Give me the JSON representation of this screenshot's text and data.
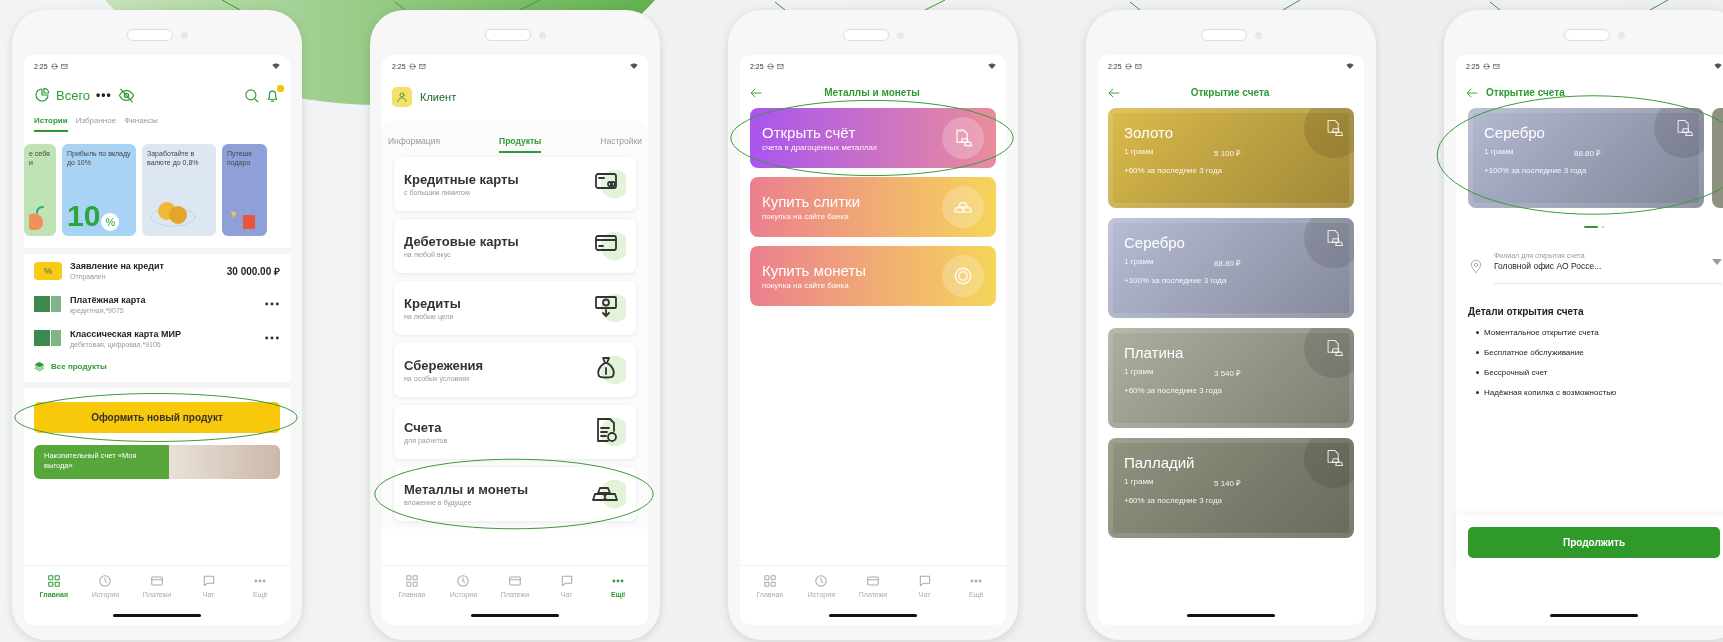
{
  "screens": [
    {
      "kind": "home",
      "status_bar": {
        "time": "2:25"
      },
      "header": {
        "title": "Всего",
        "balance_mask": "•••"
      },
      "tabs": [
        {
          "label": "Истории",
          "selected": true
        },
        {
          "label": "Избранное",
          "selected": false
        },
        {
          "label": "Финансы",
          "selected": false
        }
      ],
      "stories": [
        {
          "kind": "heart",
          "text": "е себя и",
          "color": "#bfe3b4"
        },
        {
          "kind": "percent",
          "text": "Прибыль по вкладу до 10%",
          "art_text": "10",
          "art_mark": "%",
          "color": "#a9d3f5"
        },
        {
          "kind": "coins",
          "text": "Заработайте в валюте до 0,8%",
          "color": "#dde7f2"
        },
        {
          "kind": "gift",
          "text": "Путеше подаро",
          "color": "#8fa0d8"
        }
      ],
      "products": [
        {
          "kind": "application",
          "icon_text": "%",
          "title": "Заявление на кредит",
          "subtitle": "Отправлен",
          "amount": "30 000.00 ₽"
        },
        {
          "kind": "card",
          "title": "Платёжная карта",
          "subtitle": "кредитная,*9075"
        },
        {
          "kind": "card",
          "title": "Классическая карта МИР",
          "subtitle": "дебетовая, цифровая,*9106"
        }
      ],
      "all_products_link": "Все продукты",
      "new_product_button": {
        "label": "Оформить новый продукт",
        "highlighted": true
      },
      "promo": {
        "text": "Накопительный счет «Моя выгода»"
      },
      "nav": [
        {
          "kind": "home",
          "label": "Главная",
          "selected": true
        },
        {
          "kind": "history",
          "label": "История",
          "selected": false
        },
        {
          "kind": "payments",
          "label": "Платежи",
          "selected": false
        },
        {
          "kind": "chat",
          "label": "Чат",
          "selected": false
        },
        {
          "kind": "more",
          "label": "Ещё",
          "selected": false
        }
      ]
    },
    {
      "kind": "profile",
      "status_bar": {
        "time": "2:25"
      },
      "client": "Клиент",
      "tabs": [
        {
          "label": "Информация",
          "selected": false
        },
        {
          "label": "Продукты",
          "selected": true
        },
        {
          "label": "Настройки",
          "selected": false
        }
      ],
      "products": [
        {
          "kind": "credit_card",
          "title": "Кредитные карты",
          "subtitle": "с большим лимитом",
          "highlighted": false
        },
        {
          "kind": "debit_card",
          "title": "Дебетовые карты",
          "subtitle": "на любой вкус",
          "highlighted": false
        },
        {
          "kind": "loan",
          "title": "Кредиты",
          "subtitle": "на любые цели",
          "highlighted": false
        },
        {
          "kind": "savings",
          "title": "Сбережения",
          "subtitle": "на особых условиях",
          "highlighted": false
        },
        {
          "kind": "accounts",
          "title": "Счета",
          "subtitle": "для расчетов",
          "highlighted": false
        },
        {
          "kind": "metals",
          "title": "Металлы и монеты",
          "subtitle": "вложение в будущее",
          "highlighted": true
        }
      ],
      "nav": [
        {
          "kind": "home",
          "label": "Главная",
          "selected": false
        },
        {
          "kind": "history",
          "label": "История",
          "selected": false
        },
        {
          "kind": "payments",
          "label": "Платежи",
          "selected": false
        },
        {
          "kind": "chat",
          "label": "Чат",
          "selected": false
        },
        {
          "kind": "more",
          "label": "Ещё",
          "selected": true
        }
      ]
    },
    {
      "kind": "metals_menu",
      "status_bar": {
        "time": "2:25"
      },
      "title": "Металлы и монеты",
      "tiles": [
        {
          "kind": "account",
          "title": "Открыть счёт",
          "subtitle": "счета в драгоценных металлах",
          "color": "#a955ef",
          "highlighted": true
        },
        {
          "kind": "bars",
          "title": "Купить слитки",
          "subtitle": "покупка на сайте банка",
          "color": "#ec7f8f",
          "highlighted": false
        },
        {
          "kind": "coin",
          "title": "Купить монеты",
          "subtitle": "покупка на сайте банка",
          "color": "#ec7f8f",
          "highlighted": false
        }
      ],
      "nav": [
        {
          "kind": "home",
          "label": "Главная",
          "selected": false
        },
        {
          "kind": "history",
          "label": "История",
          "selected": false
        },
        {
          "kind": "payments",
          "label": "Платежи",
          "selected": false
        },
        {
          "kind": "chat",
          "label": "Чат",
          "selected": false
        },
        {
          "kind": "more",
          "label": "Ещё",
          "selected": false
        }
      ]
    },
    {
      "kind": "metal_list",
      "status_bar": {
        "time": "2:25"
      },
      "title": "Открытие счета",
      "metals": [
        {
          "name": "Золото",
          "unit": "1 грамм",
          "price": "5 100 ₽",
          "growth": "+60% за последние 3 года",
          "color": "#dcbb4c"
        },
        {
          "name": "Серебро",
          "unit": "1 грамм",
          "price": "88.80 ₽",
          "growth": "+100% за последние 3 года",
          "color": "#b7bdd5"
        },
        {
          "name": "Платина",
          "unit": "1 грамм",
          "price": "3 540 ₽",
          "growth": "+60% за последние 3 года",
          "color": "#adaf9f"
        },
        {
          "name": "Палладий",
          "unit": "1 грамм",
          "price": "5 140 ₽",
          "growth": "+60% за последние 3 года",
          "color": "#91947f"
        }
      ]
    },
    {
      "kind": "account_form",
      "status_bar": {
        "time": "2:25"
      },
      "title": "Открытие счета",
      "cards": [
        {
          "name": "Серебро",
          "unit": "1 грамм",
          "price": "88.80 ₽",
          "growth": "+100% за последние 3 года",
          "color": "#b3b9d2",
          "highlighted": true
        },
        {
          "color": "#8e917f"
        }
      ],
      "pager": [
        {
          "selected": true
        },
        {
          "selected": false
        }
      ],
      "branch_field": {
        "label": "Филиал для открытия счета",
        "value": "Головной офис АО Россе..."
      },
      "details": {
        "title": "Детали открытия счета",
        "items": [
          "Моментальное открытие счета",
          "Бесплатное обслуживание",
          "Бессрочный счет",
          "Надёжная копилка с возможностью"
        ]
      },
      "continue_button": "Продолжить"
    }
  ]
}
